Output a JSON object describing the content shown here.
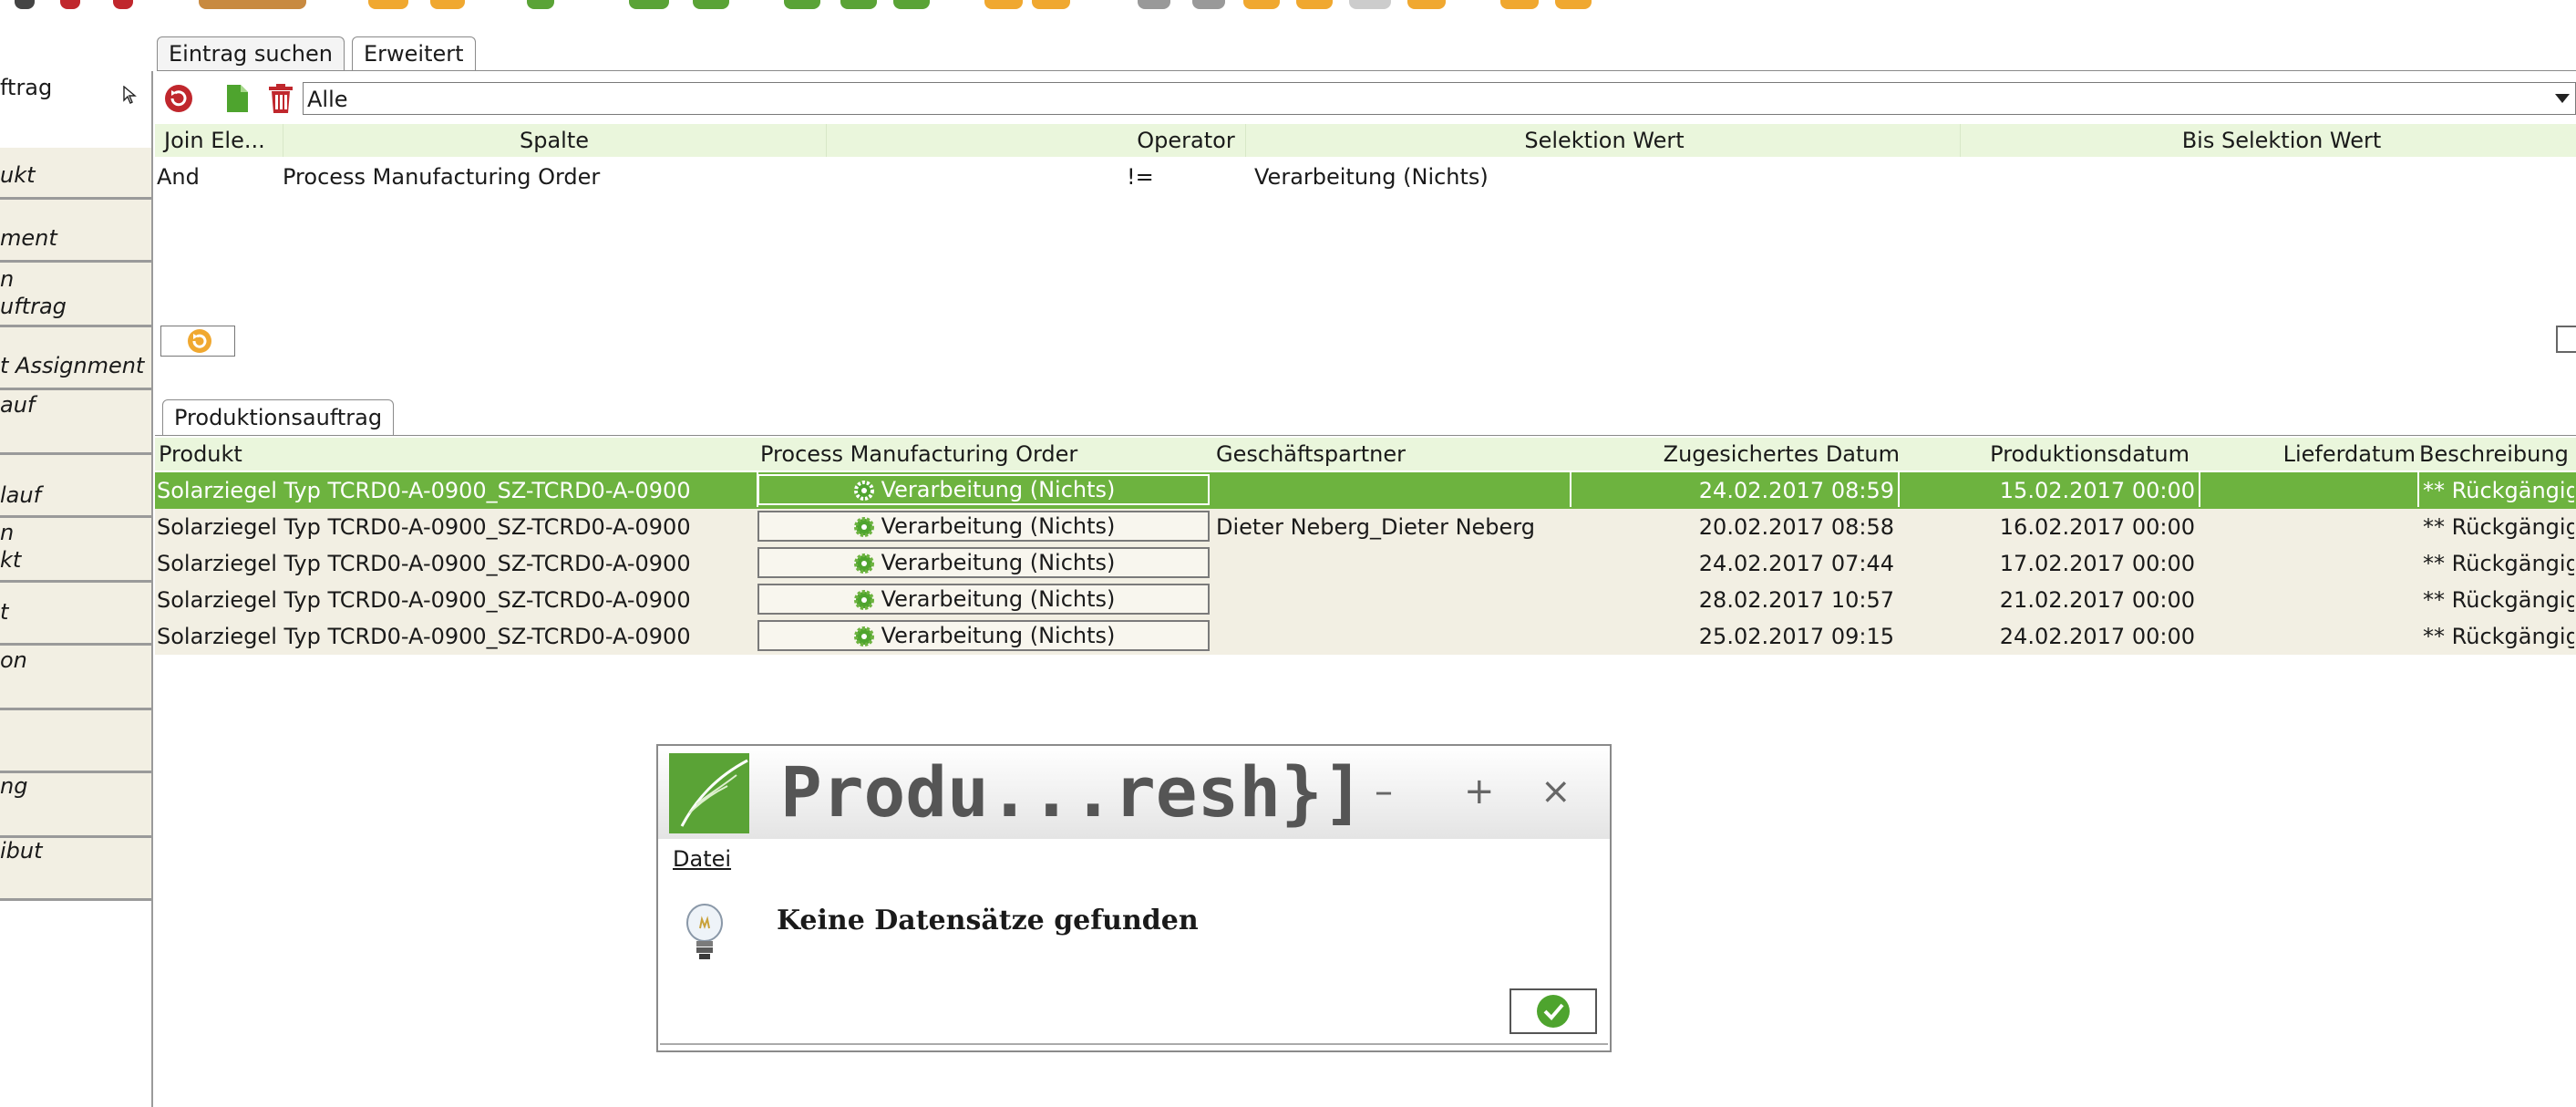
{
  "search_tabs": [
    "Eintrag suchen",
    "Erweitert"
  ],
  "sidebar": {
    "top_label": "ftrag",
    "items": [
      {
        "lines": [
          "ukt"
        ]
      },
      {
        "lines": [
          "ment"
        ]
      },
      {
        "lines": [
          "n",
          "uftrag"
        ]
      },
      {
        "lines": [
          "t Assignment"
        ]
      },
      {
        "lines": [
          "auf"
        ]
      },
      {
        "lines": [
          "lauf"
        ]
      },
      {
        "lines": [
          "n",
          "kt"
        ]
      },
      {
        "lines": [
          "t"
        ]
      },
      {
        "lines": [
          "on"
        ]
      },
      {
        "lines": [
          ""
        ]
      },
      {
        "lines": [
          "ng"
        ]
      },
      {
        "lines": [
          "ibut"
        ]
      }
    ]
  },
  "query": {
    "select_value": "Alle",
    "headers": [
      "Join Ele...",
      "Spalte",
      "Operator",
      "Selektion Wert",
      "Bis Selektion Wert"
    ],
    "rows": [
      {
        "join": "And",
        "column": "Process Manufacturing Order",
        "operator": "!=",
        "value": "Verarbeitung (Nichts)",
        "to_value": ""
      }
    ]
  },
  "result_tab": "Produktionsauftrag",
  "results": {
    "headers": [
      "Produkt",
      "Process Manufacturing Order",
      "Geschäftspartner",
      "Zugesichertes Datum",
      "Produktionsdatum",
      "Lieferdatum",
      "Beschreibung"
    ],
    "rows": [
      {
        "product": "Solarziegel Typ TCRD0-A-0900_SZ-TCRD0-A-0900",
        "process": "Verarbeitung (Nichts)",
        "partner": "",
        "promised": "24.02.2017 08:59",
        "production": "15.02.2017 00:00",
        "delivery": "",
        "description": "** Rückgängig...",
        "selected": true
      },
      {
        "product": "Solarziegel Typ TCRD0-A-0900_SZ-TCRD0-A-0900",
        "process": "Verarbeitung (Nichts)",
        "partner": "Dieter Neberg_Dieter Neberg",
        "promised": "20.02.2017 08:58",
        "production": "16.02.2017 00:00",
        "delivery": "",
        "description": "** Rückgängig...",
        "selected": false
      },
      {
        "product": "Solarziegel Typ TCRD0-A-0900_SZ-TCRD0-A-0900",
        "process": "Verarbeitung (Nichts)",
        "partner": "",
        "promised": "24.02.2017 07:44",
        "production": "17.02.2017 00:00",
        "delivery": "",
        "description": "** Rückgängig...",
        "selected": false
      },
      {
        "product": "Solarziegel Typ TCRD0-A-0900_SZ-TCRD0-A-0900",
        "process": "Verarbeitung (Nichts)",
        "partner": "",
        "promised": "28.02.2017 10:57",
        "production": "21.02.2017 00:00",
        "delivery": "",
        "description": "** Rückgängig...",
        "selected": false
      },
      {
        "product": "Solarziegel Typ TCRD0-A-0900_SZ-TCRD0-A-0900",
        "process": "Verarbeitung (Nichts)",
        "partner": "",
        "promised": "25.02.2017 09:15",
        "production": "24.02.2017 00:00",
        "delivery": "",
        "description": "** Rückgängig...",
        "selected": false
      }
    ]
  },
  "dialog": {
    "title": "Produ...resh}]",
    "menu": "Datei",
    "message": "Keine Datensätze gefunden",
    "controls": {
      "minimize": "–",
      "maximize": "+",
      "close": "×"
    }
  },
  "colors": {
    "accent_green": "#6db33f",
    "header_green": "#eaf6dc",
    "row_beige": "#f2efe3",
    "icon_red": "#c0272d",
    "icon_orange": "#f0a830"
  }
}
